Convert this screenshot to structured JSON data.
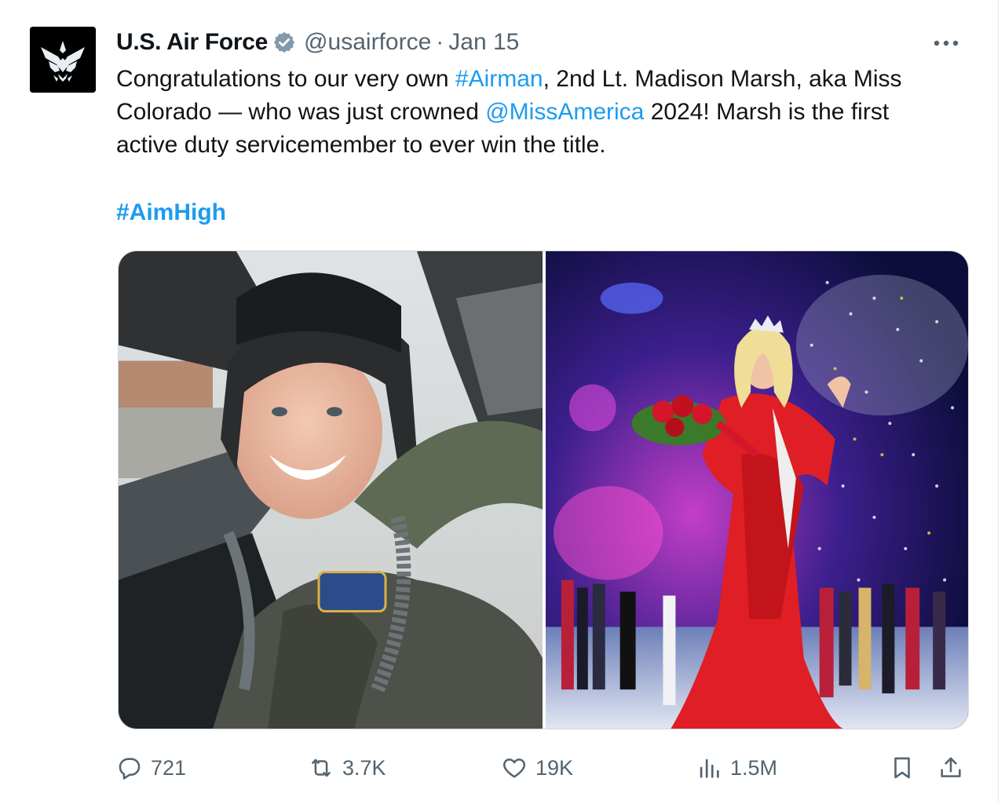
{
  "tweet": {
    "author_name": "U.S. Air Force",
    "handle": "@usairforce",
    "separator": "·",
    "date": "Jan 15",
    "avatar_icon": "air-force-wings-icon",
    "verified_icon": "verified-badge-icon",
    "text": {
      "l1_a": "Congratulations to our very own ",
      "l1_link": "#Airman",
      "l1_b": ", 2nd Lt. Madison Marsh, aka Miss",
      "l2_a": "Colorado — who was just crowned ",
      "l2_link": "@MissAmerica",
      "l2_b": " 2024! Marsh is the first",
      "l3": "active duty servicemember to ever win the title."
    },
    "hashtag": "#AimHigh",
    "media": [
      {
        "alt_icon": "photo-pilot-in-cockpit"
      },
      {
        "alt_icon": "photo-miss-america-crowning"
      }
    ],
    "actions": {
      "replies": "721",
      "retweets": "3.7K",
      "likes": "19K",
      "views": "1.5M"
    }
  },
  "colors": {
    "link": "#1d9bf0",
    "secondary_text": "#536471",
    "text": "#0f1419",
    "verified_badge": "#829aab"
  }
}
